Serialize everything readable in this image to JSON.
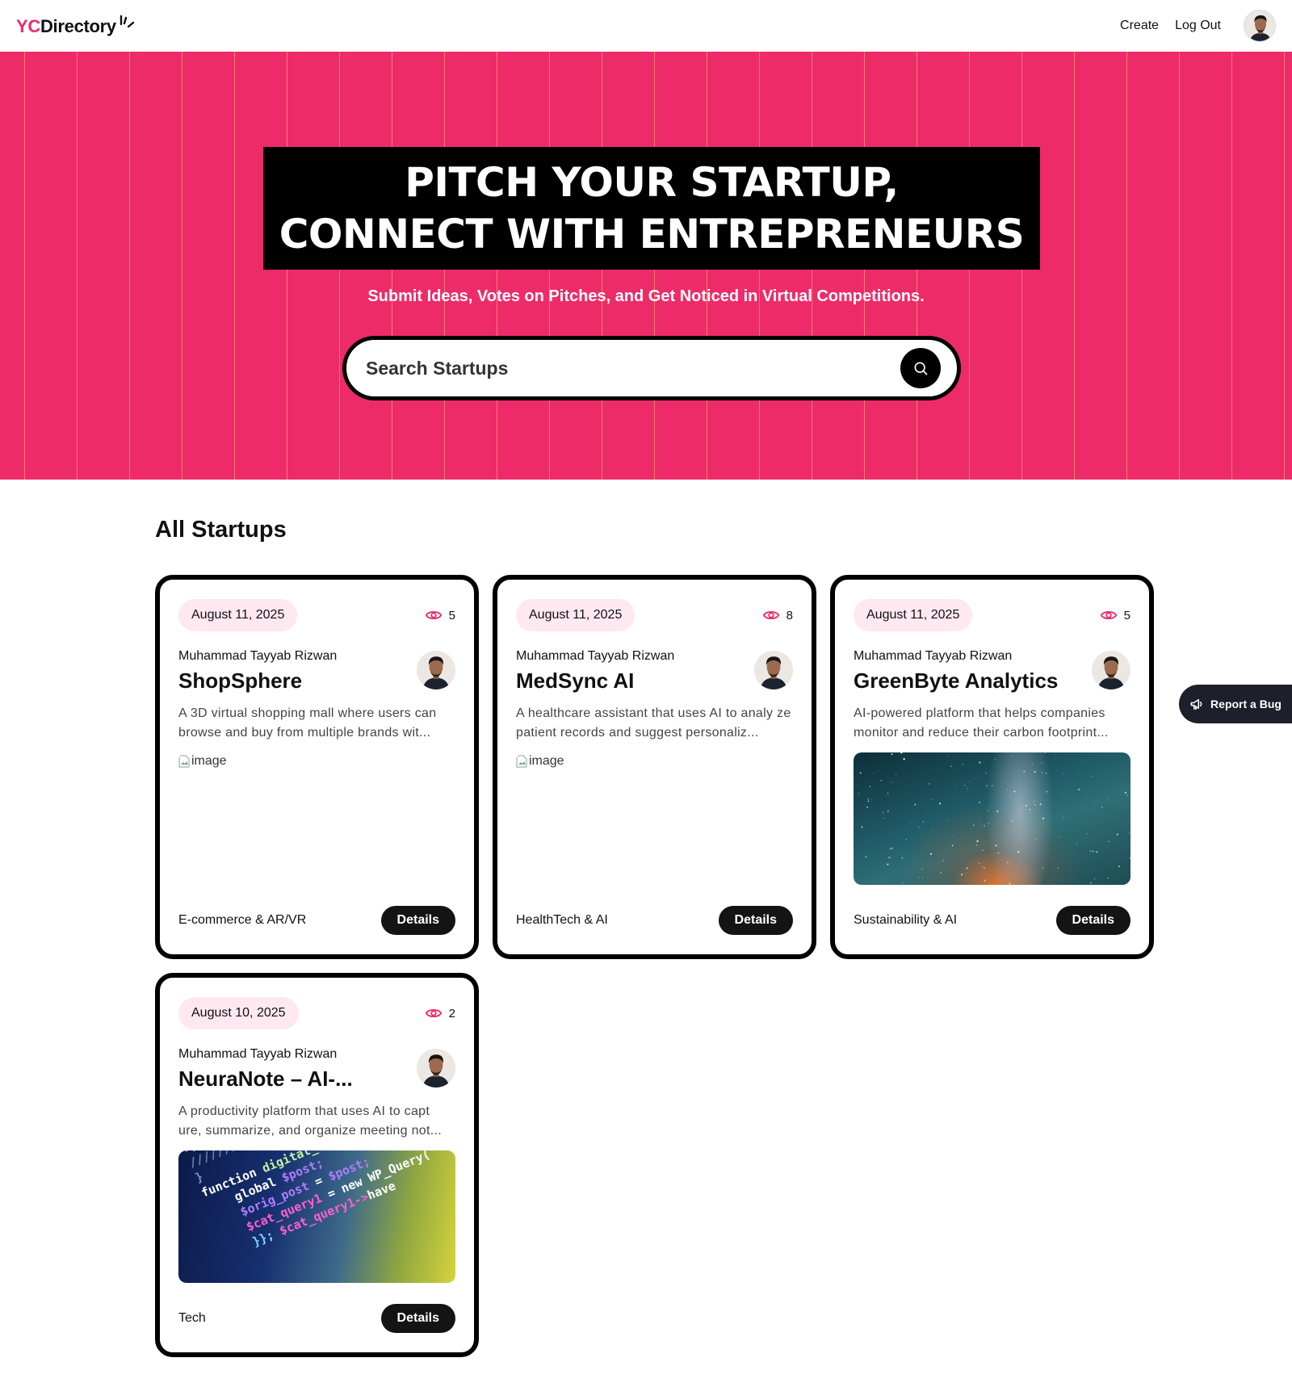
{
  "navbar": {
    "logo_prefix": "YC",
    "logo_rest": "Directory",
    "create_label": "Create",
    "logout_label": "Log Out"
  },
  "hero": {
    "title_line1": "Pitch Your Startup,",
    "title_line2": "Connect With Entrepreneurs",
    "subtitle": "Submit Ideas, Votes on Pitches, and Get Noticed in Virtual Competitions.",
    "search_placeholder": "Search Startups"
  },
  "main": {
    "section_title": "All Startups",
    "cards": [
      {
        "date": "August 11, 2025",
        "views": "5",
        "author": "Muhammad Tayyab Rizwan",
        "title": "ShopSphere",
        "description": "A 3D virtual shopping mall where users can browse and buy from multiple brands wit...",
        "image_alt": "image",
        "category": "E-commerce & AR/VR",
        "details_label": "Details"
      },
      {
        "date": "August 11, 2025",
        "views": "8",
        "author": "Muhammad Tayyab Rizwan",
        "title": "MedSync AI",
        "description": "A healthcare assistant that uses AI to analy ze patient records and suggest personaliz...",
        "image_alt": "image",
        "category": "HealthTech & AI",
        "details_label": "Details"
      },
      {
        "date": "August 11, 2025",
        "views": "5",
        "author": "Muhammad Tayyab Rizwan",
        "title": "GreenByte Analytics",
        "description": "AI-powered platform that helps companies monitor and reduce their carbon footprint...",
        "category": "Sustainability & AI",
        "details_label": "Details"
      },
      {
        "date": "August 10, 2025",
        "views": "2",
        "author": "Muhammad Tayyab Rizwan",
        "title": "NeuraNote – AI-...",
        "description": "A productivity platform that uses AI to capt ure, summarize, and organize meeting not...",
        "category": "Tech",
        "details_label": "Details"
      }
    ]
  },
  "report_bug": {
    "label": "Report a Bug"
  },
  "colors": {
    "brand_pink": "#ee2b69",
    "badge_pink": "#ffe8f0",
    "dark": "#141414"
  }
}
